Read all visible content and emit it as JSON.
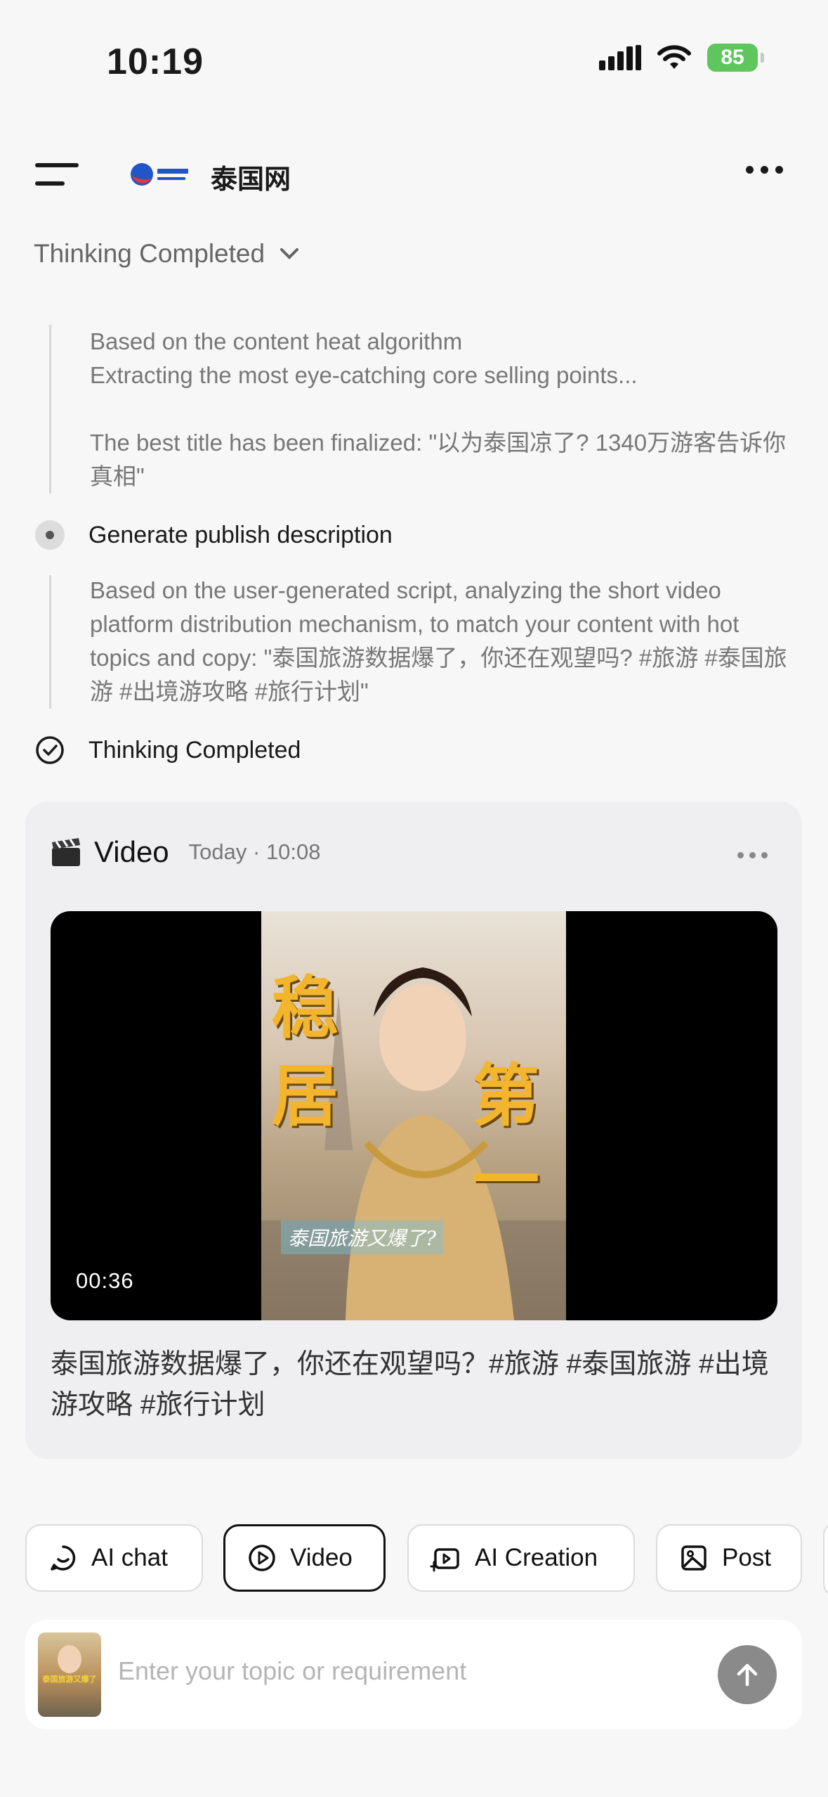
{
  "status_bar": {
    "time": "10:19",
    "battery": "85"
  },
  "header": {
    "title": "泰国网",
    "logo_text": "泰国网"
  },
  "thinking": {
    "toggle_label": "Thinking Completed",
    "block1_line1": "Based on the content heat algorithm",
    "block1_line2": "Extracting the most eye-catching core selling points...",
    "block1_line3": "The best title has been finalized: \"以为泰国凉了? 1340万游客告诉你真相\"",
    "step2_label": "Generate publish description",
    "block2_text": "Based on the user-generated script, analyzing the short video platform distribution mechanism, to match your content with hot topics and copy: \"泰国旅游数据爆了，你还在观望吗? #旅游 #泰国旅游 #出境游攻略 #旅行计划\"",
    "done_label": "Thinking Completed"
  },
  "video_card": {
    "title": "Video",
    "time": "Today · 10:08",
    "duration": "00:36",
    "overlay_left1": "稳",
    "overlay_left2": "居",
    "overlay_right1": "第",
    "overlay_right2": "一",
    "overlay_subtitle": "泰国旅游又爆了?",
    "caption": "泰国旅游数据爆了，你还在观望吗？#旅游 #泰国旅游 #出境游攻略 #旅行计划"
  },
  "tabs": [
    {
      "label": "AI chat",
      "icon": "ai-chat-icon"
    },
    {
      "label": "Video",
      "icon": "play-circle-icon",
      "active": true
    },
    {
      "label": "AI Creation",
      "icon": "ai-creation-icon"
    },
    {
      "label": "Post",
      "icon": "image-icon"
    }
  ],
  "composer": {
    "placeholder": "Enter your topic or requirement",
    "thumb_text": "泰国旅游又爆了"
  },
  "colors": {
    "accent": "#111111",
    "battery": "#5ec65c",
    "send_button": "#8a8a8a",
    "overlay_text": "#f4b52e"
  }
}
